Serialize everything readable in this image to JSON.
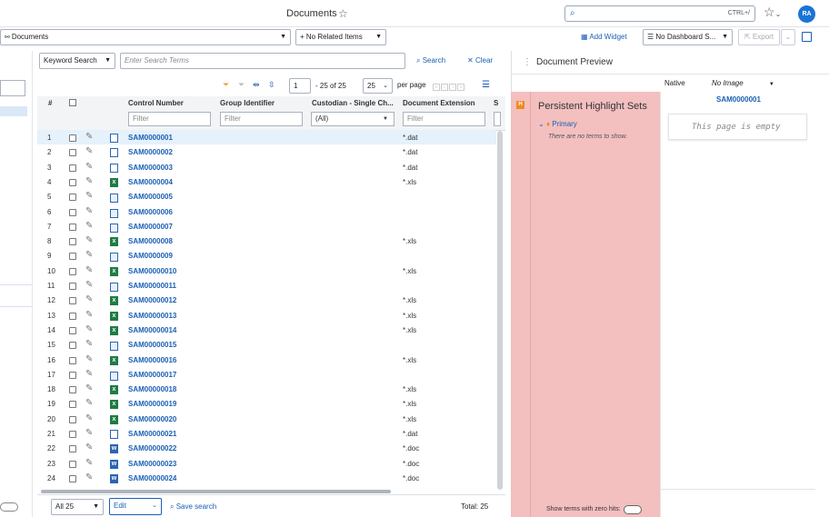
{
  "header": {
    "title": "Documents",
    "search_shortcut": "CTRL+/",
    "avatar_initials": "RA"
  },
  "toolbar": {
    "view_select": "Documents",
    "related_items": "+ No Related Items",
    "add_widget": "Add Widget",
    "dashboard_select": "No Dashboard S...",
    "export": "Export"
  },
  "search_bar": {
    "mode": "Keyword Search",
    "placeholder": "Enter Search Terms",
    "search_label": "Search",
    "clear_label": "Clear"
  },
  "pagination": {
    "page": "1",
    "range_text": "- 25 of 25",
    "per_page_value": "25",
    "per_page_label": "per page"
  },
  "grid": {
    "columns": [
      "#",
      "Control Number",
      "Group Identifier",
      "Custodian - Single Ch...",
      "Document Extension",
      "S"
    ],
    "filter_placeholder": "Filter",
    "custodian_filter": "(All)",
    "rows": [
      {
        "n": "1",
        "ctrl": "SAM0000001",
        "ext": "*.dat",
        "type": "dat"
      },
      {
        "n": "2",
        "ctrl": "SAM0000002",
        "ext": "*.dat",
        "type": "dat"
      },
      {
        "n": "3",
        "ctrl": "SAM0000003",
        "ext": "*.dat",
        "type": "dat"
      },
      {
        "n": "4",
        "ctrl": "SAM0000004",
        "ext": "*.xls",
        "type": "xls"
      },
      {
        "n": "5",
        "ctrl": "SAM0000005",
        "ext": "",
        "type": "msg"
      },
      {
        "n": "6",
        "ctrl": "SAM0000006",
        "ext": "",
        "type": "msg"
      },
      {
        "n": "7",
        "ctrl": "SAM0000007",
        "ext": "",
        "type": "msg"
      },
      {
        "n": "8",
        "ctrl": "SAM0000008",
        "ext": "*.xls",
        "type": "xls"
      },
      {
        "n": "9",
        "ctrl": "SAM0000009",
        "ext": "",
        "type": "msg"
      },
      {
        "n": "10",
        "ctrl": "SAM00000010",
        "ext": "*.xls",
        "type": "xls"
      },
      {
        "n": "11",
        "ctrl": "SAM00000011",
        "ext": "",
        "type": "msg"
      },
      {
        "n": "12",
        "ctrl": "SAM00000012",
        "ext": "*.xls",
        "type": "xls"
      },
      {
        "n": "13",
        "ctrl": "SAM00000013",
        "ext": "*.xls",
        "type": "xls"
      },
      {
        "n": "14",
        "ctrl": "SAM00000014",
        "ext": "*.xls",
        "type": "xls"
      },
      {
        "n": "15",
        "ctrl": "SAM00000015",
        "ext": "",
        "type": "msg"
      },
      {
        "n": "16",
        "ctrl": "SAM00000016",
        "ext": "*.xls",
        "type": "xls"
      },
      {
        "n": "17",
        "ctrl": "SAM00000017",
        "ext": "",
        "type": "msg"
      },
      {
        "n": "18",
        "ctrl": "SAM00000018",
        "ext": "*.xls",
        "type": "xls"
      },
      {
        "n": "19",
        "ctrl": "SAM00000019",
        "ext": "*.xls",
        "type": "xls"
      },
      {
        "n": "20",
        "ctrl": "SAM00000020",
        "ext": "*.xls",
        "type": "xls"
      },
      {
        "n": "21",
        "ctrl": "SAM00000021",
        "ext": "*.dat",
        "type": "dat"
      },
      {
        "n": "22",
        "ctrl": "SAM00000022",
        "ext": "*.doc",
        "type": "doc"
      },
      {
        "n": "23",
        "ctrl": "SAM00000023",
        "ext": "*.doc",
        "type": "doc"
      },
      {
        "n": "24",
        "ctrl": "SAM00000024",
        "ext": "*.doc",
        "type": "doc"
      }
    ]
  },
  "footer": {
    "all_select": "All 25",
    "edit_select": "Edit",
    "save_search": "Save search",
    "total": "Total: 25"
  },
  "preview": {
    "title": "Document Preview",
    "native_label": "Native",
    "image_label": "No Image",
    "doc_id": "SAM0000001",
    "empty_text": "This page is empty",
    "highlight_title": "Persistent Highlight Sets",
    "primary_label": "Primary",
    "no_terms": "There are no terms to show.",
    "zero_hits": "Show terms with zero hits:"
  },
  "colors": {
    "accent": "#1a5fb4",
    "highlight_panel": "#f3bfbf",
    "active_row": "#e5f1fb",
    "excel_green": "#1e7c45"
  }
}
